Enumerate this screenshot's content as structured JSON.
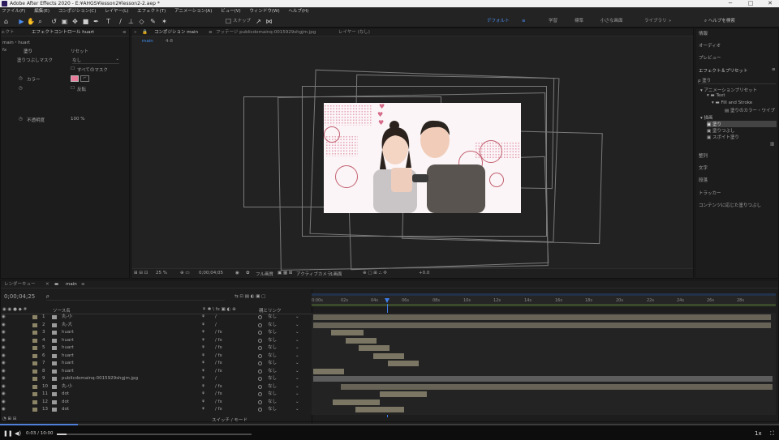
{
  "window": {
    "title": "Adobe After Effects 2020 - E:¥AHGS¥lesson2¥lesson2-2.aep *",
    "controls": [
      "─",
      "□",
      "✕"
    ]
  },
  "menu": [
    "ファイル(F)",
    "編集(E)",
    "コンポジション(C)",
    "レイヤー(L)",
    "エフェクト(T)",
    "アニメーション(A)",
    "ビュー(V)",
    "ウィンドウ(W)",
    "ヘルプ(H)"
  ],
  "toolbar": {
    "snap_label": "スナップ",
    "workspaces": [
      "デフォルト",
      "学習",
      "標準",
      "小さな画面",
      "ライブラリ"
    ],
    "active_workspace": "デフォルト",
    "help_search": "ヘルプを検索"
  },
  "effect_controls": {
    "left_tab_fragment": "ェクト",
    "tab": "エフェクトコントロール huart",
    "layer_path": "main・huart",
    "fx_name": "塗り",
    "reset": "リセット",
    "mask_label": "塗りつぶしマスク",
    "mask_value": "なし",
    "all_masks": "すべてのマスク",
    "color_label": "カラー",
    "invert": "反転",
    "opacity_label": "不透明度",
    "opacity_value": "100 %",
    "color_hex": "#e97a9a"
  },
  "composition": {
    "tab": "コンポジション main",
    "footage_tab": "フッテージ publicdomainq-0015929shgjm.jpg",
    "layer_tab": "レイヤー (なし)",
    "subtabs": [
      "main",
      "4-8"
    ],
    "zoom": "25 %",
    "timecode": "0;00;04;05",
    "resolution": "フル画質",
    "camera": "アクティブカメラ",
    "views": "1画面",
    "exposure": "+0.0"
  },
  "right_panel": {
    "sections_top": [
      "情報",
      "オーディオ",
      "プレビュー"
    ],
    "presets_title": "エフェクト＆プリセット",
    "search_value": "塗り",
    "tree": [
      "アニメーションプリセット",
      "Text",
      "Fill and Stroke",
      "塗りのカラー・ワイプ",
      "描画",
      "塗り",
      "塗りつぶし",
      "スポイト塗り"
    ],
    "sections_bottom": [
      "整列",
      "文字",
      "段落",
      "トラッカー",
      "コンテンツに応じた塗りつぶし"
    ]
  },
  "timeline": {
    "tabs": [
      "レンダーキュー",
      "main"
    ],
    "timecode": "0;00;04;25",
    "search_placeholder": "ρ",
    "col_source": "ソース名",
    "col_parent": "親とリンク",
    "switch_mode": "スイッチ / モード",
    "ticks": [
      "0:00s",
      "02s",
      "04s",
      "06s",
      "08s",
      "10s",
      "12s",
      "14s",
      "16s",
      "18s",
      "20s",
      "22s",
      "24s",
      "26s",
      "28s"
    ],
    "layers": [
      {
        "num": "1",
        "name": "丸-小",
        "fx": "/",
        "parent": "なし"
      },
      {
        "num": "2",
        "name": "丸-大",
        "fx": "/",
        "parent": "なし"
      },
      {
        "num": "3",
        "name": "huart",
        "fx": "/ fx",
        "parent": "なし"
      },
      {
        "num": "4",
        "name": "huart",
        "fx": "/ fx",
        "parent": "なし"
      },
      {
        "num": "5",
        "name": "huart",
        "fx": "/ fx",
        "parent": "なし"
      },
      {
        "num": "6",
        "name": "huart",
        "fx": "/ fx",
        "parent": "なし"
      },
      {
        "num": "7",
        "name": "huart",
        "fx": "/ fx",
        "parent": "なし"
      },
      {
        "num": "8",
        "name": "huart",
        "fx": "/ fx",
        "parent": "なし"
      },
      {
        "num": "9",
        "name": "publicdomainq-0015929shgjm.jpg",
        "fx": "/",
        "parent": "なし"
      },
      {
        "num": "10",
        "name": "丸-小",
        "fx": "/ fx",
        "parent": "なし"
      },
      {
        "num": "11",
        "name": "dot",
        "fx": "/ fx",
        "parent": "なし"
      },
      {
        "num": "12",
        "name": "dot",
        "fx": "/ fx",
        "parent": "なし"
      },
      {
        "num": "13",
        "name": "dot",
        "fx": "/ fx",
        "parent": "なし"
      }
    ]
  },
  "player": {
    "time": "0:03 / 10:00",
    "speed": "1x"
  }
}
